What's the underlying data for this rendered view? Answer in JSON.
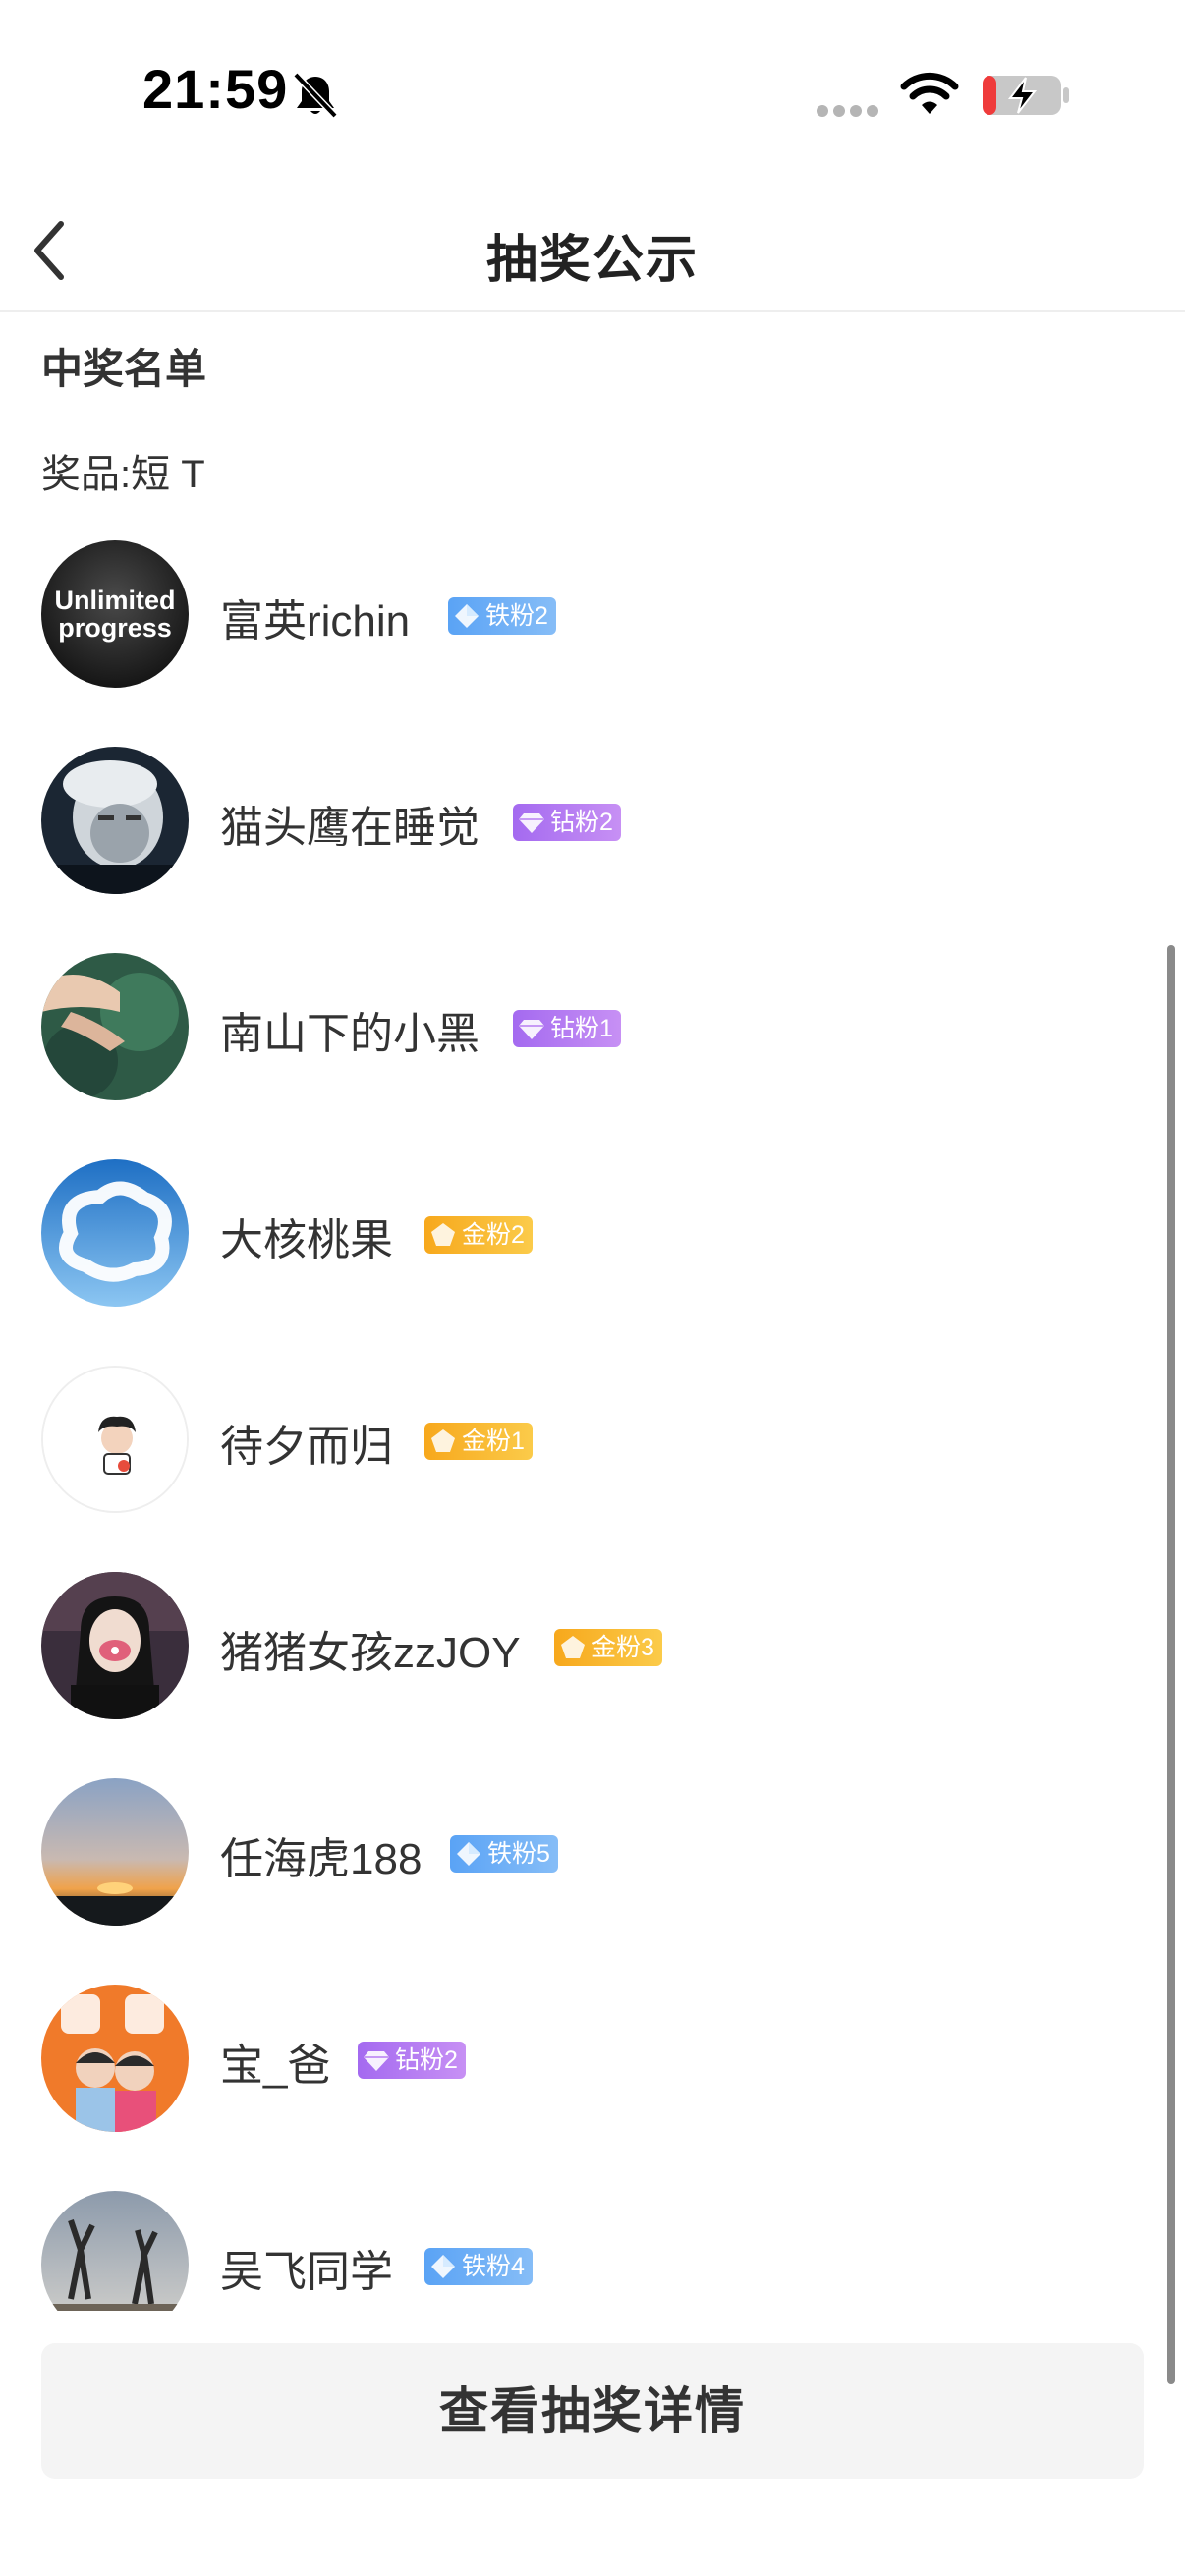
{
  "status_bar": {
    "time": "21:59",
    "icons": [
      "bell-muted-icon",
      "signal-dots-icon",
      "wifi-icon",
      "battery-charging-icon"
    ]
  },
  "nav": {
    "back_icon": "chevron-left-icon",
    "title": "抽奖公示"
  },
  "section": {
    "title": "中奖名单",
    "prize": "奖品:短 T"
  },
  "winners": [
    {
      "name": "富英richin",
      "badge": "铁粉2",
      "badge_type": "iron"
    },
    {
      "name": "猫头鹰在睡觉",
      "badge": "钻粉2",
      "badge_type": "diamond"
    },
    {
      "name": "南山下的小黑",
      "badge": "钻粉1",
      "badge_type": "diamond"
    },
    {
      "name": "大核桃果",
      "badge": "金粉2",
      "badge_type": "gold"
    },
    {
      "name": "待夕而归",
      "badge": "金粉1",
      "badge_type": "gold"
    },
    {
      "name": "猪猪女孩zzJOY",
      "badge": "金粉3",
      "badge_type": "gold"
    },
    {
      "name": "任海虎188",
      "badge": "铁粉5",
      "badge_type": "iron"
    },
    {
      "name": "宝_爸",
      "badge": "钻粉2",
      "badge_type": "diamond"
    },
    {
      "name": "吴飞同学",
      "badge": "铁粉4",
      "badge_type": "iron"
    }
  ],
  "avatar_text": {
    "first_line1": "Unlimited",
    "first_line2": "progress"
  },
  "button": {
    "label": "查看抽奖详情"
  },
  "colors": {
    "iron_badge": "#5aa3f5",
    "diamond_badge": "#a46af0",
    "gold_badge": "#f7a81c",
    "button_bg": "#f4f4f4"
  }
}
